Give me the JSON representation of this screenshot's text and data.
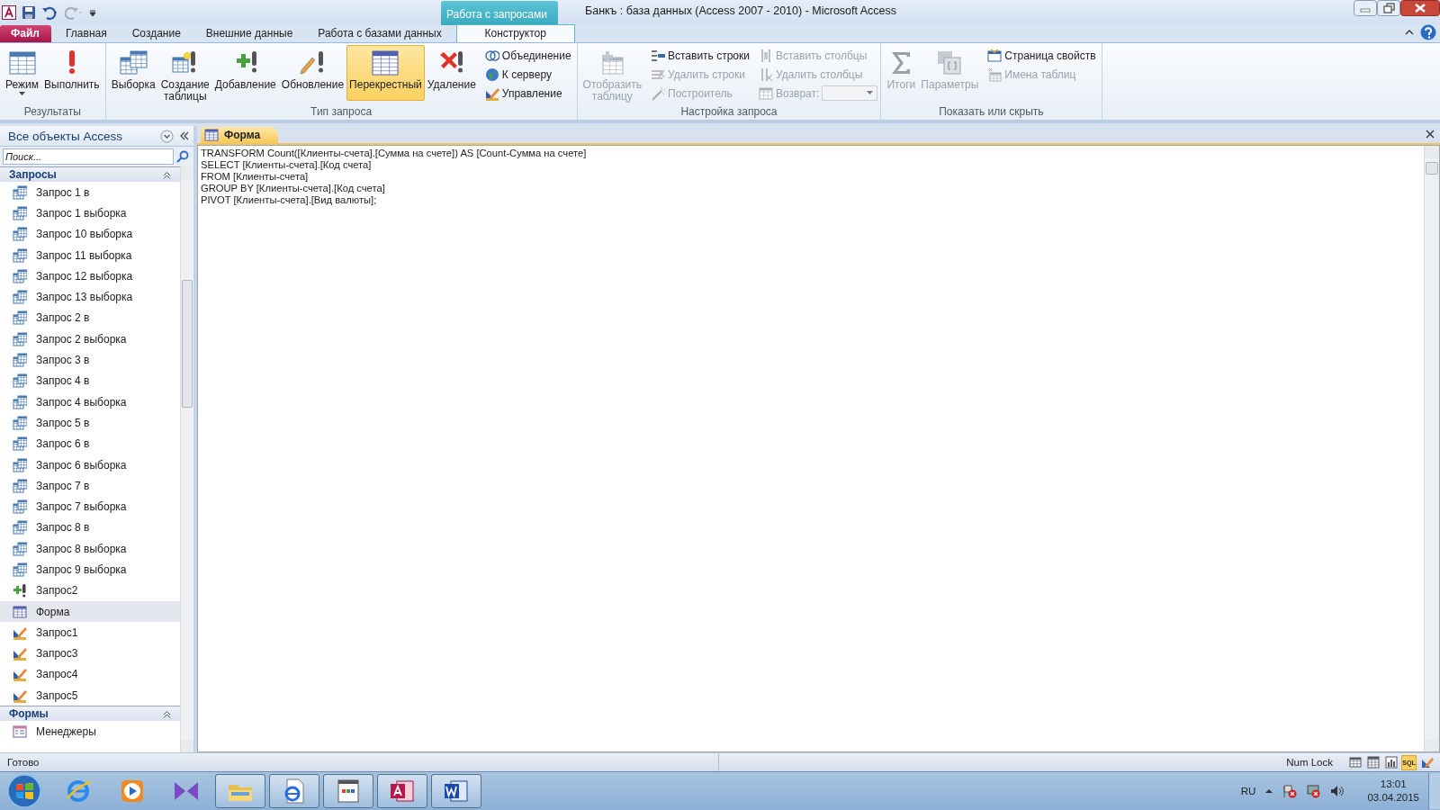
{
  "window": {
    "title": "Банкъ : база данных (Access 2007 - 2010)  -  Microsoft Access",
    "context_tab_group": "Работа с запросами"
  },
  "tabs": [
    {
      "label": "Файл",
      "kind": "file",
      "selected": false
    },
    {
      "label": "Главная",
      "kind": "plain",
      "selected": false
    },
    {
      "label": "Создание",
      "kind": "plain",
      "selected": false
    },
    {
      "label": "Внешние данные",
      "kind": "plain",
      "selected": false
    },
    {
      "label": "Работа с базами данных",
      "kind": "plain",
      "selected": false
    },
    {
      "label": "Конструктор",
      "kind": "contextual",
      "selected": true
    }
  ],
  "ribbon_groups": [
    {
      "title": "Результаты",
      "buttons": [
        {
          "label": "Режим",
          "kind": "split",
          "disabled": false,
          "selected": false
        },
        {
          "label": "Выполнить",
          "kind": "large",
          "disabled": false,
          "selected": false
        }
      ]
    },
    {
      "title": "Тип запроса",
      "buttons": [
        {
          "label": "Выборка",
          "kind": "large",
          "disabled": false,
          "selected": false
        },
        {
          "label": "Создание таблицы",
          "kind": "large",
          "disabled": false,
          "selected": false
        },
        {
          "label": "Добавление",
          "kind": "large",
          "disabled": false,
          "selected": false
        },
        {
          "label": "Обновление",
          "kind": "large",
          "disabled": false,
          "selected": false
        },
        {
          "label": "Перекрестный",
          "kind": "large",
          "disabled": false,
          "selected": true
        },
        {
          "label": "Удаление",
          "kind": "large",
          "disabled": false,
          "selected": false
        },
        {
          "label": "Объединение",
          "kind": "small",
          "disabled": false,
          "selected": false
        },
        {
          "label": "К серверу",
          "kind": "small",
          "disabled": false,
          "selected": false
        },
        {
          "label": "Управление",
          "kind": "small",
          "disabled": false,
          "selected": false
        }
      ]
    },
    {
      "title": "Настройка запроса",
      "buttons": [
        {
          "label": "Отобразить таблицу",
          "kind": "large",
          "disabled": true,
          "selected": false
        },
        {
          "label": "Вставить строки",
          "kind": "small",
          "disabled": false,
          "selected": false
        },
        {
          "label": "Удалить строки",
          "kind": "small",
          "disabled": true,
          "selected": false
        },
        {
          "label": "Построитель",
          "kind": "small",
          "disabled": true,
          "selected": false
        },
        {
          "label": "Вставить столбцы",
          "kind": "small",
          "disabled": true,
          "selected": false
        },
        {
          "label": "Удалить столбцы",
          "kind": "small",
          "disabled": true,
          "selected": false
        },
        {
          "label": "Возврат:",
          "kind": "combo",
          "disabled": true,
          "selected": false
        }
      ]
    },
    {
      "title": "Показать или скрыть",
      "buttons": [
        {
          "label": "Итоги",
          "kind": "large",
          "disabled": true,
          "selected": false
        },
        {
          "label": "Параметры",
          "kind": "large",
          "disabled": true,
          "selected": false
        },
        {
          "label": "Страница свойств",
          "kind": "small",
          "disabled": false,
          "selected": false
        },
        {
          "label": "Имена таблиц",
          "kind": "small",
          "disabled": true,
          "selected": false
        }
      ]
    }
  ],
  "navigation_pane": {
    "title": "Все объекты Access",
    "search": {
      "placeholder": "Поиск..."
    },
    "groups": [
      {
        "title": "Запросы",
        "expanded": true,
        "items": [
          {
            "label": "Запрос 1 в",
            "kind": "select",
            "selected": false
          },
          {
            "label": "Запрос 1 выборка",
            "kind": "select",
            "selected": false
          },
          {
            "label": "Запрос 10 выборка",
            "kind": "select",
            "selected": false
          },
          {
            "label": "Запрос 11 выборка",
            "kind": "select",
            "selected": false
          },
          {
            "label": "Запрос 12 выборка",
            "kind": "select",
            "selected": false
          },
          {
            "label": "Запрос 13 выборка",
            "kind": "select",
            "selected": false
          },
          {
            "label": "Запрос 2 в",
            "kind": "select",
            "selected": false
          },
          {
            "label": "Запрос 2 выборка",
            "kind": "select",
            "selected": false
          },
          {
            "label": "Запрос 3 в",
            "kind": "select",
            "selected": false
          },
          {
            "label": "Запрос 4 в",
            "kind": "select",
            "selected": false
          },
          {
            "label": "Запрос 4 выборка",
            "kind": "select",
            "selected": false
          },
          {
            "label": "Запрос 5 в",
            "kind": "select",
            "selected": false
          },
          {
            "label": "Запрос 6 в",
            "kind": "select",
            "selected": false
          },
          {
            "label": "Запрос 6 выборка",
            "kind": "select",
            "selected": false
          },
          {
            "label": "Запрос 7 в",
            "kind": "select",
            "selected": false
          },
          {
            "label": "Запрос 7 выборка",
            "kind": "select",
            "selected": false
          },
          {
            "label": "Запрос 8 в",
            "kind": "select",
            "selected": false
          },
          {
            "label": "Запрос 8 выборка",
            "kind": "select",
            "selected": false
          },
          {
            "label": "Запрос 9 выборка",
            "kind": "select",
            "selected": false
          },
          {
            "label": "Запрос2",
            "kind": "append",
            "selected": false
          },
          {
            "label": "Форма",
            "kind": "crosstab",
            "selected": true
          },
          {
            "label": "Запрос1",
            "kind": "ddl",
            "selected": false
          },
          {
            "label": "Запрос3",
            "kind": "ddl",
            "selected": false
          },
          {
            "label": "Запрос4",
            "kind": "ddl",
            "selected": false
          },
          {
            "label": "Запрос5",
            "kind": "ddl",
            "selected": false
          }
        ]
      },
      {
        "title": "Формы",
        "expanded": true,
        "items": [
          {
            "label": "Менеджеры",
            "kind": "form",
            "selected": false
          }
        ]
      }
    ]
  },
  "document_tab": {
    "label": "Форма",
    "selected": true
  },
  "sql_lines": [
    "TRANSFORM Count([Клиенты-счета].[Сумма на счете]) AS [Count-Сумма на счете]",
    "SELECT [Клиенты-счета].[Код счета]",
    "FROM [Клиенты-счета]",
    "GROUP BY [Клиенты-счета].[Код счета]",
    "PIVOT [Клиенты-счета].[Вид валюты];"
  ],
  "status_bar": {
    "text": "Готово",
    "num_lock": "Num Lock",
    "views": [
      {
        "kind": "datasheet",
        "selected": false
      },
      {
        "kind": "pivottable",
        "selected": false
      },
      {
        "kind": "pivotchart",
        "selected": false
      },
      {
        "kind": "sql",
        "label": "SQL",
        "selected": true
      },
      {
        "kind": "design",
        "selected": false
      }
    ]
  },
  "taskbar": {
    "apps": [
      {
        "kind": "browser",
        "running": false
      },
      {
        "kind": "media",
        "running": false
      },
      {
        "kind": "studio",
        "running": false
      },
      {
        "kind": "folder",
        "running": true
      },
      {
        "kind": "webdoc",
        "running": true
      },
      {
        "kind": "document",
        "running": true
      },
      {
        "kind": "access",
        "running": true
      },
      {
        "kind": "word",
        "running": true
      }
    ],
    "language": "RU",
    "time": "13:01",
    "date": "03.04.2015"
  }
}
